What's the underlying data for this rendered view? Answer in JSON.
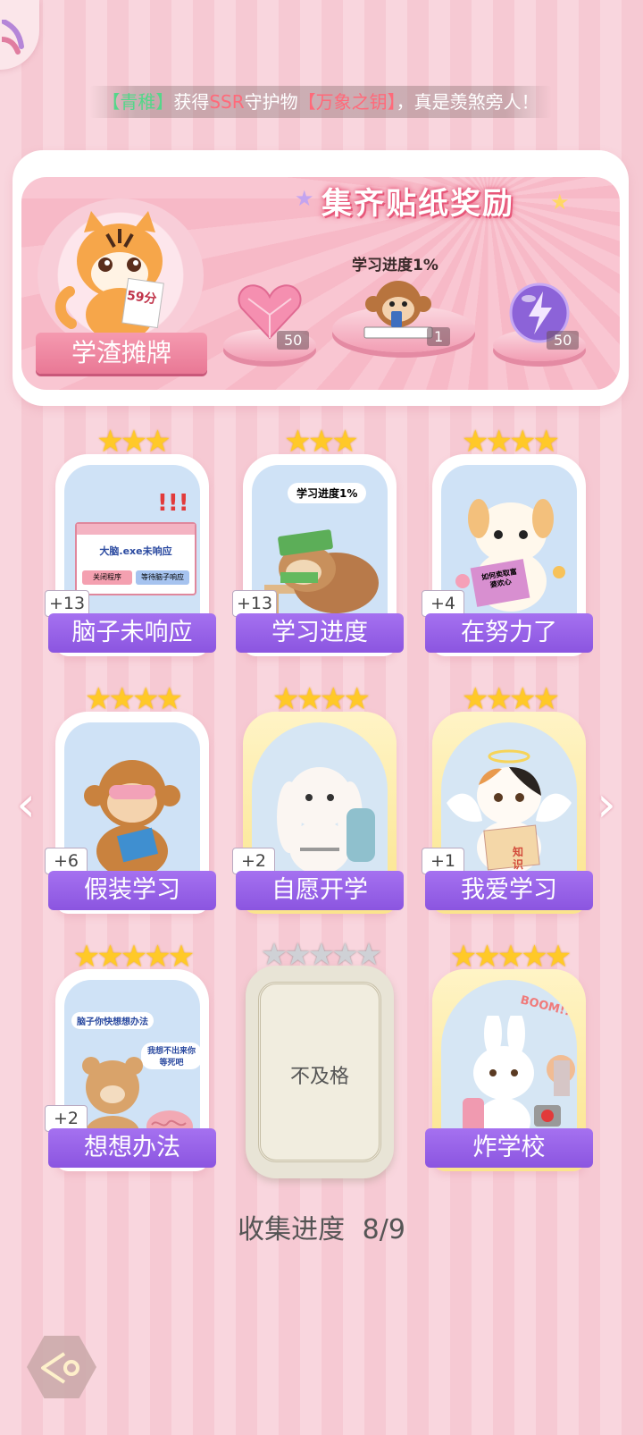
{
  "ticker": {
    "part1": "【青稚】",
    "part2": "获得",
    "part3": "SSR",
    "part4": "守护物",
    "part5": "【万象之钥】",
    "part6": "，真是羡煞旁人！"
  },
  "banner": {
    "title": "集齐贴纸奖励",
    "ribbon": "学渣摊牌",
    "tiger_paper": "59分",
    "progress_text": "学习进度1%",
    "rewards": [
      {
        "icon": "heart-gem-icon",
        "count": "50"
      },
      {
        "icon": "monkey-sticker-icon",
        "count": "1"
      },
      {
        "icon": "energy-orb-icon",
        "count": "50"
      }
    ]
  },
  "cards": [
    {
      "name": "脑子未响应",
      "count": "+13",
      "stars": "★★★",
      "art_text": "大脑.exe未响应",
      "btn1": "关闭程序",
      "btn2": "等待脑子响应"
    },
    {
      "name": "学习进度",
      "count": "+13",
      "stars": "★★★",
      "art_text": "学习进度1%"
    },
    {
      "name": "在努力了",
      "count": "+4",
      "stars": "★★★★",
      "art_text": "如何卖取富婆欢心"
    },
    {
      "name": "假装学习",
      "count": "+6",
      "stars": "★★★★"
    },
    {
      "name": "自愿开学",
      "count": "+2",
      "stars": "★★★★"
    },
    {
      "name": "我爱学习",
      "count": "+1",
      "stars": "★★★★",
      "art_text": "知识"
    },
    {
      "name": "想想办法",
      "count": "+2",
      "stars": "★★★★★",
      "bubble1": "脑子你快想想办法",
      "bubble2": "我想不出来你等死吧"
    },
    {
      "name": "不及格",
      "locked": true,
      "stars": "★★★★★"
    },
    {
      "name": "炸学校",
      "stars": "★★★★★",
      "art_text": "BOOM!!"
    }
  ],
  "collect": {
    "label": "收集进度",
    "value": "8/9"
  },
  "nav": {
    "prev_icon": "chevron-left-icon",
    "next_icon": "chevron-right-icon",
    "back_icon": "back-arrow-icon"
  }
}
